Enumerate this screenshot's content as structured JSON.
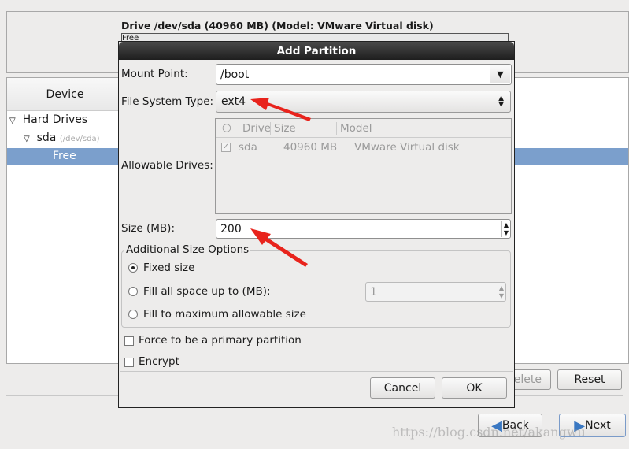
{
  "drive_label": "Drive /dev/sda (40960 MB) (Model: VMware Virtual disk)",
  "drive_bar_text": "Free",
  "tree": {
    "header": "Device",
    "hard_drives": "Hard Drives",
    "sda": "sda",
    "sda_path": "(/dev/sda)",
    "free": "Free"
  },
  "buttons": {
    "delete": "Delete",
    "reset": "Reset",
    "back": "Back",
    "next": "Next"
  },
  "dialog": {
    "title": "Add Partition",
    "mount_point_label": "Mount Point:",
    "mount_point_value": "/boot",
    "fs_type_label": "File System Type:",
    "fs_type_value": "ext4",
    "allowable_label": "Allowable Drives:",
    "drives_columns": [
      "Drive",
      "Size",
      "Model"
    ],
    "drives_rows": [
      {
        "checked": true,
        "drive": "sda",
        "size": "40960 MB",
        "model": "VMware Virtual disk"
      }
    ],
    "size_label": "Size (MB):",
    "size_value": "200",
    "additional_legend": "Additional Size Options",
    "opt_fixed": "Fixed size",
    "opt_fill_up": "Fill all space up to (MB):",
    "fill_up_value": "1",
    "opt_fill_max": "Fill to maximum allowable size",
    "selected_option": "Fixed size",
    "force_primary": "Force to be a primary partition",
    "encrypt": "Encrypt",
    "cancel": "Cancel",
    "ok": "OK"
  },
  "annotation_color": "#e8231c",
  "watermark": "https://blog.csdn.net/akangwu"
}
